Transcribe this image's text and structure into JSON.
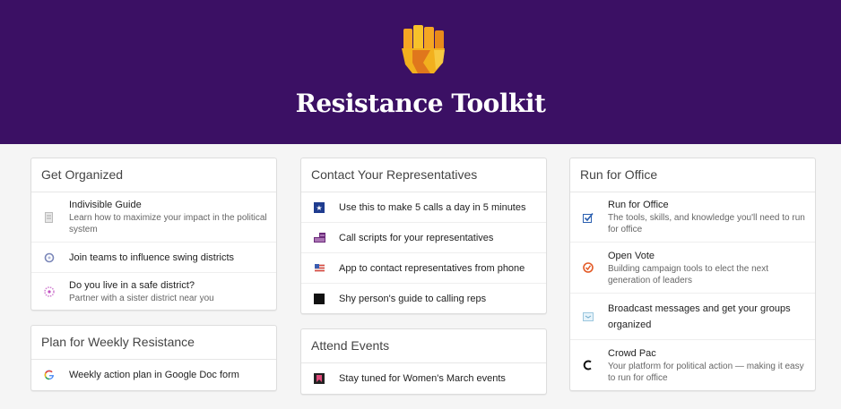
{
  "header": {
    "title": "Resistance Toolkit",
    "background": "#3b1064",
    "logo_icon": "raised-fist-logo"
  },
  "columns": [
    {
      "cards": [
        {
          "title": "Get Organized",
          "items": [
            {
              "icon": "document-icon",
              "title": "Indivisible Guide",
              "desc": "Learn how to maximize your impact in the political system"
            },
            {
              "icon": "swing-left-icon",
              "title": "Join teams to influence swing districts",
              "desc": ""
            },
            {
              "icon": "sister-district-icon",
              "title": "Do you live in a safe district?",
              "desc": "Partner with a sister district near you"
            }
          ]
        },
        {
          "title": "Plan for Weekly Resistance",
          "items": [
            {
              "icon": "google-icon",
              "title": "Weekly action plan in Google Doc form",
              "desc": ""
            }
          ]
        }
      ]
    },
    {
      "cards": [
        {
          "title": "Contact Your Representatives",
          "items": [
            {
              "icon": "five-calls-icon",
              "title": "Use this to make 5 calls a day in 5 minutes",
              "desc": ""
            },
            {
              "icon": "script-flag-icon",
              "title": "Call scripts for your representatives",
              "desc": ""
            },
            {
              "icon": "app-flag-icon",
              "title": "App to contact representatives from phone",
              "desc": ""
            },
            {
              "icon": "black-square-icon",
              "title": "Shy person's guide to calling reps",
              "desc": ""
            }
          ]
        },
        {
          "title": "Attend Events",
          "items": [
            {
              "icon": "womens-march-icon",
              "title": "Stay tuned for Women's March events",
              "desc": ""
            }
          ]
        }
      ]
    },
    {
      "cards": [
        {
          "title": "Run for Office",
          "items": [
            {
              "icon": "checkbox-icon",
              "title": "Run for Office",
              "desc": "The tools, skills, and knowledge you'll need to run for office"
            },
            {
              "icon": "open-vote-icon",
              "title": "Open Vote",
              "desc": "Building campaign tools to elect the next generation of leaders"
            },
            {
              "icon": "broadcast-icon",
              "title": "Broadcast messages and get your groups organized",
              "desc": ""
            },
            {
              "icon": "crowd-pac-icon",
              "title": "Crowd Pac",
              "desc": "Your platform for political action — making it easy to run for office"
            }
          ]
        }
      ]
    }
  ]
}
